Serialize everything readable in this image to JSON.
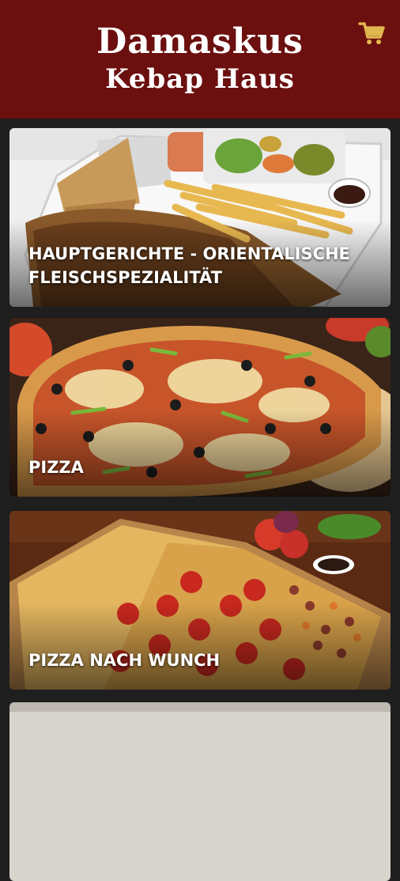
{
  "header": {
    "brand_line1": "Damaskus",
    "brand_line2": "Kebap Haus",
    "background": "#6b0f0f",
    "cart_icon": "shopping-cart-icon",
    "cart_color": "#e0b64e"
  },
  "categories": [
    {
      "label": "HAUPTGERICHTE - ORIENTALISCHE FLEISCHSPEZIALITÄT"
    },
    {
      "label": "PIZZA"
    },
    {
      "label": "PIZZA NACH WUNCH"
    },
    {
      "label": ""
    }
  ]
}
